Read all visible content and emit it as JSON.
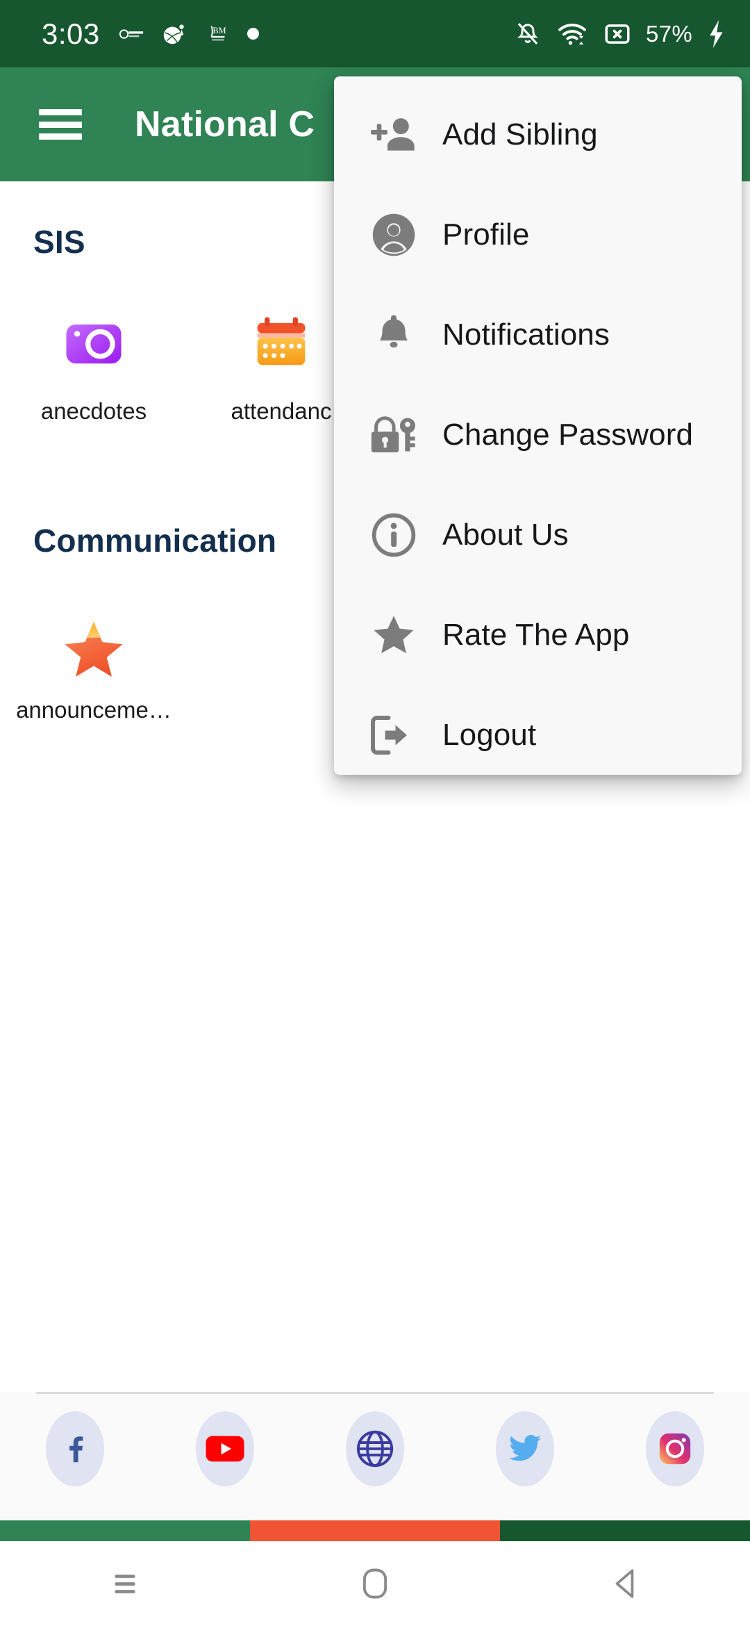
{
  "status_bar": {
    "time": "3:03",
    "battery": "57%",
    "icons": [
      "app-badge-lakshya",
      "app-badge-sports",
      "app-badge-jbm",
      "notification-dot-icon"
    ],
    "right_icons": [
      "bell-off-icon",
      "wifi-icon",
      "sim-card-off-icon",
      "battery-charging-icon"
    ],
    "background": "#175730"
  },
  "app_bar": {
    "menu_icon": "hamburger-menu-icon",
    "title": "National C",
    "background": "#2F8354"
  },
  "sections": [
    {
      "title": "SIS",
      "tiles": [
        {
          "label": "anecdotes",
          "icon": "camera-icon",
          "color": "#A935F5"
        },
        {
          "label": "attendanc",
          "icon": "calendar-icon",
          "color": "#F5A623"
        }
      ]
    },
    {
      "title": "Communication",
      "tiles": [
        {
          "label": "announceme…",
          "icon": "star-icon",
          "color": "#F0532B"
        }
      ]
    }
  ],
  "dropdown_menu": {
    "items": [
      {
        "label": "Add Sibling",
        "icon": "person-add-icon"
      },
      {
        "label": "Profile",
        "icon": "account-circle-icon"
      },
      {
        "label": "Notifications",
        "icon": "bell-icon"
      },
      {
        "label": "Change Password",
        "icon": "lock-key-icon"
      },
      {
        "label": "About Us",
        "icon": "info-circle-icon"
      },
      {
        "label": "Rate The App",
        "icon": "star-icon"
      },
      {
        "label": "Logout",
        "icon": "logout-icon"
      }
    ]
  },
  "social_bar": {
    "items": [
      {
        "name": "facebook-icon",
        "color": "#3B5998"
      },
      {
        "name": "youtube-icon",
        "color": "#FF0000"
      },
      {
        "name": "website-icon",
        "color": "#3A3A9E"
      },
      {
        "name": "twitter-icon",
        "color": "#55ACEE"
      },
      {
        "name": "instagram-icon",
        "color": "#E1306C"
      }
    ]
  },
  "tricolor_band": {
    "colors": [
      "#2F8354",
      "#EF5434",
      "#175730"
    ]
  },
  "nav_bar": {
    "buttons": [
      {
        "name": "recents-button"
      },
      {
        "name": "home-button"
      },
      {
        "name": "back-button"
      }
    ]
  }
}
